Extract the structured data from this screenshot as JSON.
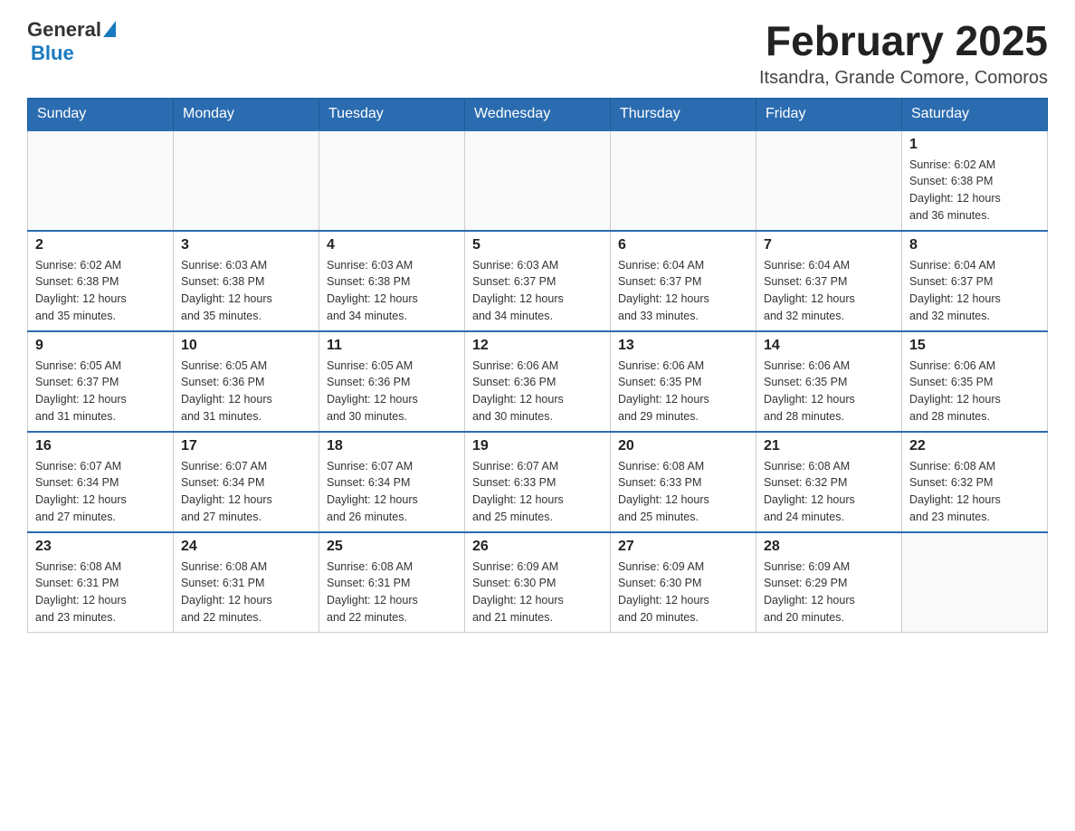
{
  "header": {
    "logo": {
      "text_general": "General",
      "text_blue": "Blue",
      "alt": "GeneralBlue logo"
    },
    "title": "February 2025",
    "subtitle": "Itsandra, Grande Comore, Comoros"
  },
  "weekdays": [
    "Sunday",
    "Monday",
    "Tuesday",
    "Wednesday",
    "Thursday",
    "Friday",
    "Saturday"
  ],
  "weeks": [
    {
      "days": [
        {
          "number": "",
          "info": ""
        },
        {
          "number": "",
          "info": ""
        },
        {
          "number": "",
          "info": ""
        },
        {
          "number": "",
          "info": ""
        },
        {
          "number": "",
          "info": ""
        },
        {
          "number": "",
          "info": ""
        },
        {
          "number": "1",
          "info": "Sunrise: 6:02 AM\nSunset: 6:38 PM\nDaylight: 12 hours\nand 36 minutes."
        }
      ]
    },
    {
      "days": [
        {
          "number": "2",
          "info": "Sunrise: 6:02 AM\nSunset: 6:38 PM\nDaylight: 12 hours\nand 35 minutes."
        },
        {
          "number": "3",
          "info": "Sunrise: 6:03 AM\nSunset: 6:38 PM\nDaylight: 12 hours\nand 35 minutes."
        },
        {
          "number": "4",
          "info": "Sunrise: 6:03 AM\nSunset: 6:38 PM\nDaylight: 12 hours\nand 34 minutes."
        },
        {
          "number": "5",
          "info": "Sunrise: 6:03 AM\nSunset: 6:37 PM\nDaylight: 12 hours\nand 34 minutes."
        },
        {
          "number": "6",
          "info": "Sunrise: 6:04 AM\nSunset: 6:37 PM\nDaylight: 12 hours\nand 33 minutes."
        },
        {
          "number": "7",
          "info": "Sunrise: 6:04 AM\nSunset: 6:37 PM\nDaylight: 12 hours\nand 32 minutes."
        },
        {
          "number": "8",
          "info": "Sunrise: 6:04 AM\nSunset: 6:37 PM\nDaylight: 12 hours\nand 32 minutes."
        }
      ]
    },
    {
      "days": [
        {
          "number": "9",
          "info": "Sunrise: 6:05 AM\nSunset: 6:37 PM\nDaylight: 12 hours\nand 31 minutes."
        },
        {
          "number": "10",
          "info": "Sunrise: 6:05 AM\nSunset: 6:36 PM\nDaylight: 12 hours\nand 31 minutes."
        },
        {
          "number": "11",
          "info": "Sunrise: 6:05 AM\nSunset: 6:36 PM\nDaylight: 12 hours\nand 30 minutes."
        },
        {
          "number": "12",
          "info": "Sunrise: 6:06 AM\nSunset: 6:36 PM\nDaylight: 12 hours\nand 30 minutes."
        },
        {
          "number": "13",
          "info": "Sunrise: 6:06 AM\nSunset: 6:35 PM\nDaylight: 12 hours\nand 29 minutes."
        },
        {
          "number": "14",
          "info": "Sunrise: 6:06 AM\nSunset: 6:35 PM\nDaylight: 12 hours\nand 28 minutes."
        },
        {
          "number": "15",
          "info": "Sunrise: 6:06 AM\nSunset: 6:35 PM\nDaylight: 12 hours\nand 28 minutes."
        }
      ]
    },
    {
      "days": [
        {
          "number": "16",
          "info": "Sunrise: 6:07 AM\nSunset: 6:34 PM\nDaylight: 12 hours\nand 27 minutes."
        },
        {
          "number": "17",
          "info": "Sunrise: 6:07 AM\nSunset: 6:34 PM\nDaylight: 12 hours\nand 27 minutes."
        },
        {
          "number": "18",
          "info": "Sunrise: 6:07 AM\nSunset: 6:34 PM\nDaylight: 12 hours\nand 26 minutes."
        },
        {
          "number": "19",
          "info": "Sunrise: 6:07 AM\nSunset: 6:33 PM\nDaylight: 12 hours\nand 25 minutes."
        },
        {
          "number": "20",
          "info": "Sunrise: 6:08 AM\nSunset: 6:33 PM\nDaylight: 12 hours\nand 25 minutes."
        },
        {
          "number": "21",
          "info": "Sunrise: 6:08 AM\nSunset: 6:32 PM\nDaylight: 12 hours\nand 24 minutes."
        },
        {
          "number": "22",
          "info": "Sunrise: 6:08 AM\nSunset: 6:32 PM\nDaylight: 12 hours\nand 23 minutes."
        }
      ]
    },
    {
      "days": [
        {
          "number": "23",
          "info": "Sunrise: 6:08 AM\nSunset: 6:31 PM\nDaylight: 12 hours\nand 23 minutes."
        },
        {
          "number": "24",
          "info": "Sunrise: 6:08 AM\nSunset: 6:31 PM\nDaylight: 12 hours\nand 22 minutes."
        },
        {
          "number": "25",
          "info": "Sunrise: 6:08 AM\nSunset: 6:31 PM\nDaylight: 12 hours\nand 22 minutes."
        },
        {
          "number": "26",
          "info": "Sunrise: 6:09 AM\nSunset: 6:30 PM\nDaylight: 12 hours\nand 21 minutes."
        },
        {
          "number": "27",
          "info": "Sunrise: 6:09 AM\nSunset: 6:30 PM\nDaylight: 12 hours\nand 20 minutes."
        },
        {
          "number": "28",
          "info": "Sunrise: 6:09 AM\nSunset: 6:29 PM\nDaylight: 12 hours\nand 20 minutes."
        },
        {
          "number": "",
          "info": ""
        }
      ]
    }
  ]
}
